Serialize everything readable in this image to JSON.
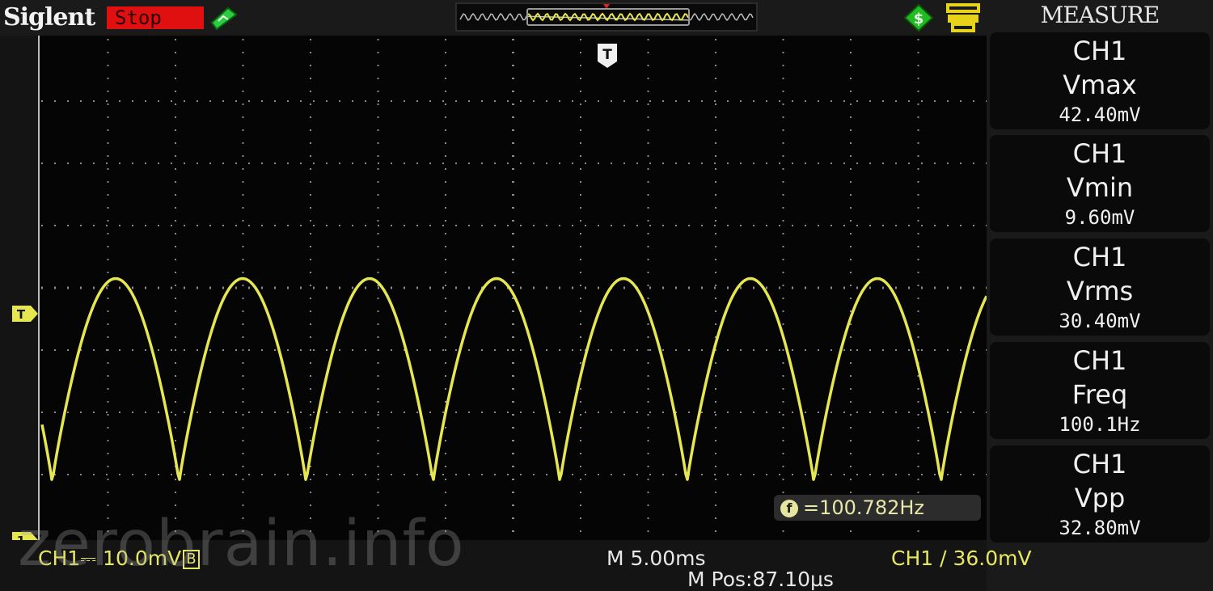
{
  "brand": "Siglent",
  "run_state": "Stop",
  "icons": {
    "trigger_status": "trigger-armed-icon",
    "usb": "usb-icon",
    "print": "print-icon",
    "trigger_position": "trigger-position-icon",
    "trigger_level": "trigger-level-icon",
    "channel1": "channel1-ground-icon",
    "frequency": "frequency-counter-icon"
  },
  "colors": {
    "channel1": "#e6e650",
    "stop_bg": "#e01010",
    "grid": "#8a8a8a"
  },
  "markers": {
    "trigger_position": "T",
    "trigger_level": "T",
    "channel1": "1"
  },
  "measure": {
    "title": "MEASURE",
    "items": [
      {
        "source": "CH1",
        "name": "Vmax",
        "value": "42.40mV"
      },
      {
        "source": "CH1",
        "name": "Vmin",
        "value": "9.60mV"
      },
      {
        "source": "CH1",
        "name": "Vrms",
        "value": "30.40mV"
      },
      {
        "source": "CH1",
        "name": "Freq",
        "value": "100.1Hz"
      },
      {
        "source": "CH1",
        "name": "Vpp",
        "value": "32.80mV"
      }
    ]
  },
  "freq_counter": {
    "symbol": "f",
    "text": "=100.782Hz"
  },
  "status": {
    "ch1_scale": "CH1⎓ 10.0mV",
    "bandwidth_badge": "B",
    "timebase": "M 5.00ms",
    "m_pos": "M Pos:87.10µs",
    "trigger": "CH1 ∕ 36.0mV"
  },
  "watermark": "zerobrain.info",
  "chart_data": {
    "type": "line",
    "title": "",
    "xlabel": "",
    "ylabel": "",
    "grid": true,
    "series": [
      {
        "values": [
          30.6,
          42.4,
          9.6,
          42.4,
          9.6,
          42.4,
          9.6,
          42.4,
          9.6,
          42.4,
          9.6,
          42.4,
          9.6,
          42.4,
          9.6,
          42.4,
          9.6,
          42.4,
          9.6,
          42.4,
          9.6,
          42.4,
          9.6,
          42.4,
          9.6,
          42.4,
          9.6,
          42.4,
          9.6,
          42.4
        ]
      }
    ]
  }
}
